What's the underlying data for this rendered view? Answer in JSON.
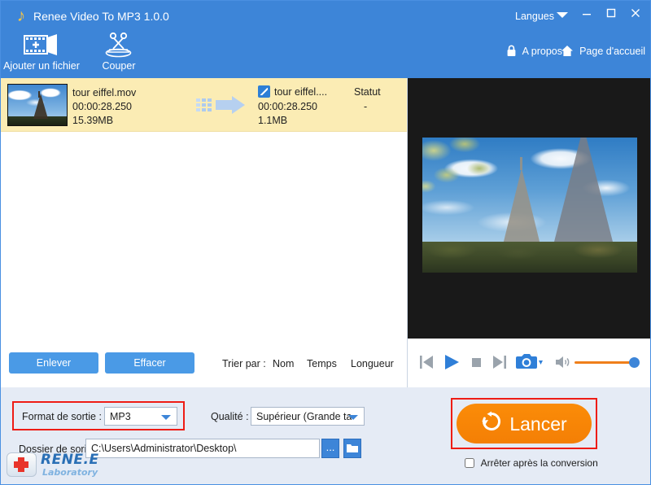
{
  "window": {
    "title": "Renee Video To MP3 1.0.0",
    "app_icon": "music-note-icon",
    "langues_label": "Langues",
    "minimize_label": "Minimiser",
    "maximize_label": "Agrandir",
    "close_label": "Fermer"
  },
  "toolbar": {
    "items": [
      {
        "label": "Ajouter un fichier",
        "icon": "add-file-icon"
      },
      {
        "label": "Couper",
        "icon": "scissors-icon"
      }
    ],
    "links": [
      {
        "label": "A propos",
        "icon": "lock-icon"
      },
      {
        "label": "Page d'accueil",
        "icon": "home-icon"
      }
    ]
  },
  "filelist": {
    "rows": [
      {
        "thumbnail": "eiffel-tower-thumbnail",
        "source_name": "tour eiffel.mov",
        "source_duration": "00:00:28.250",
        "source_size": "15.39MB",
        "arrow": "convert-arrow-icon",
        "output_icon": "edit-icon",
        "output_name": "tour eiffel....",
        "output_duration": "00:00:28.250",
        "output_size": "1.1MB",
        "status_header": "Statut",
        "status_value": "-"
      }
    ],
    "actions": {
      "remove_label": "Enlever",
      "clear_label": "Effacer",
      "sort_label": "Trier par :",
      "sort_options": [
        "Nom",
        "Temps",
        "Longueur"
      ]
    }
  },
  "preview": {
    "video_frame": "eiffel-tower-video-frame",
    "controls": [
      {
        "name": "previous-button",
        "icon": "skip-back-icon"
      },
      {
        "name": "play-button",
        "icon": "play-icon"
      },
      {
        "name": "stop-button",
        "icon": "stop-icon"
      },
      {
        "name": "next-button",
        "icon": "skip-forward-icon"
      },
      {
        "name": "snapshot-button",
        "icon": "camera-icon"
      },
      {
        "name": "volume-button",
        "icon": "speaker-icon"
      }
    ],
    "volume_percent": 100
  },
  "settings": {
    "format_label": "Format de sortie :",
    "format_value": "MP3",
    "quality_label": "Qualité :",
    "quality_value": "Supérieur (Grande ta",
    "folder_label": "Dossier de sorite :",
    "folder_value": "C:\\Users\\Administrator\\Desktop\\",
    "browse_label": "...",
    "open_folder_label": "Ouvrir le dossier"
  },
  "action": {
    "start_label": "Lancer",
    "start_icon": "refresh-icon",
    "stop_after_label": "Arrêter après la conversion",
    "stop_after_checked": false
  },
  "brand": {
    "name": "RENE.E",
    "sub": "Laboratory",
    "icon": "red-cross-logo"
  },
  "colors": {
    "header_blue": "#3d85d8",
    "accent_blue": "#4a9ae6",
    "row_yellow": "#fbecb4",
    "panel_bg": "#e5ebf5",
    "highlight_red": "#ee1c15",
    "orange": "#f47f05"
  }
}
